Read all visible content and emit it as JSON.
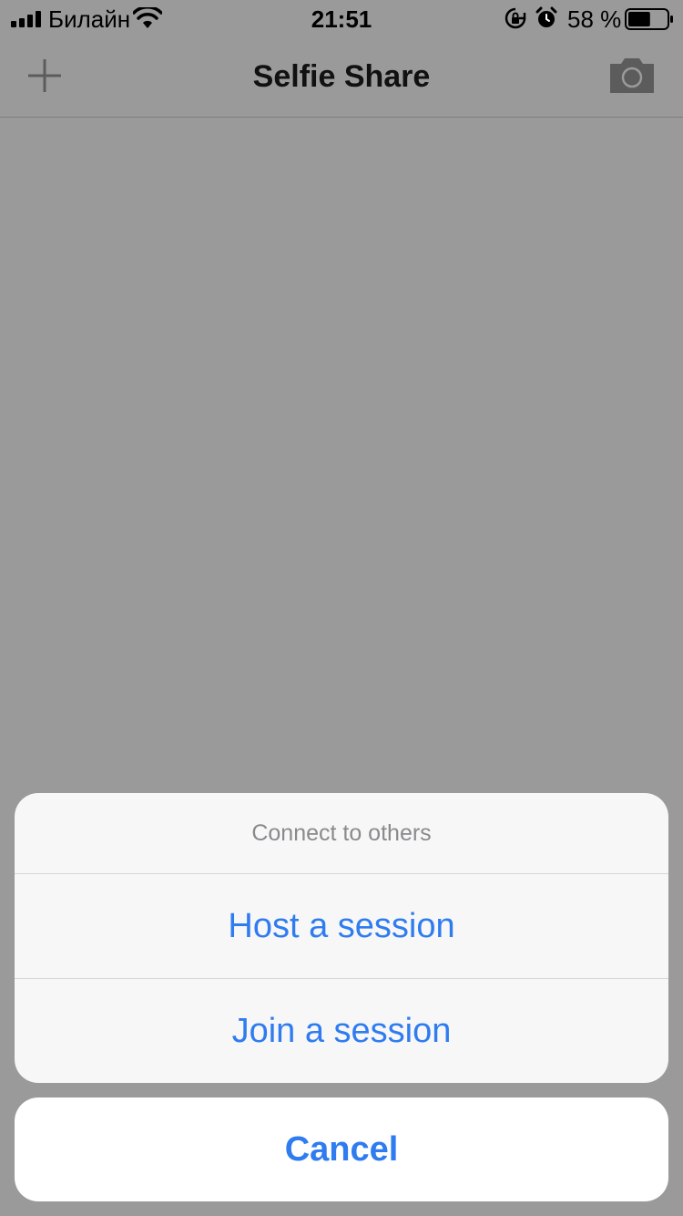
{
  "status_bar": {
    "carrier": "Билайн",
    "time": "21:51",
    "battery_percent": "58 %",
    "battery_level": 0.58,
    "icons": [
      "signal-icon",
      "wifi-icon",
      "rotation-lock-icon",
      "alarm-icon",
      "battery-icon"
    ]
  },
  "nav_bar": {
    "title": "Selfie Share",
    "left_icon": "plus-icon",
    "right_icon": "camera-icon"
  },
  "action_sheet": {
    "title": "Connect to others",
    "options": [
      {
        "label": "Host a session"
      },
      {
        "label": "Join a session"
      }
    ],
    "cancel_label": "Cancel"
  },
  "colors": {
    "overlay_background": "#9a9a9a",
    "action_tint": "#2f7cf0",
    "sheet_background": "#f7f7f7",
    "sheet_title": "#8a8a8e"
  }
}
